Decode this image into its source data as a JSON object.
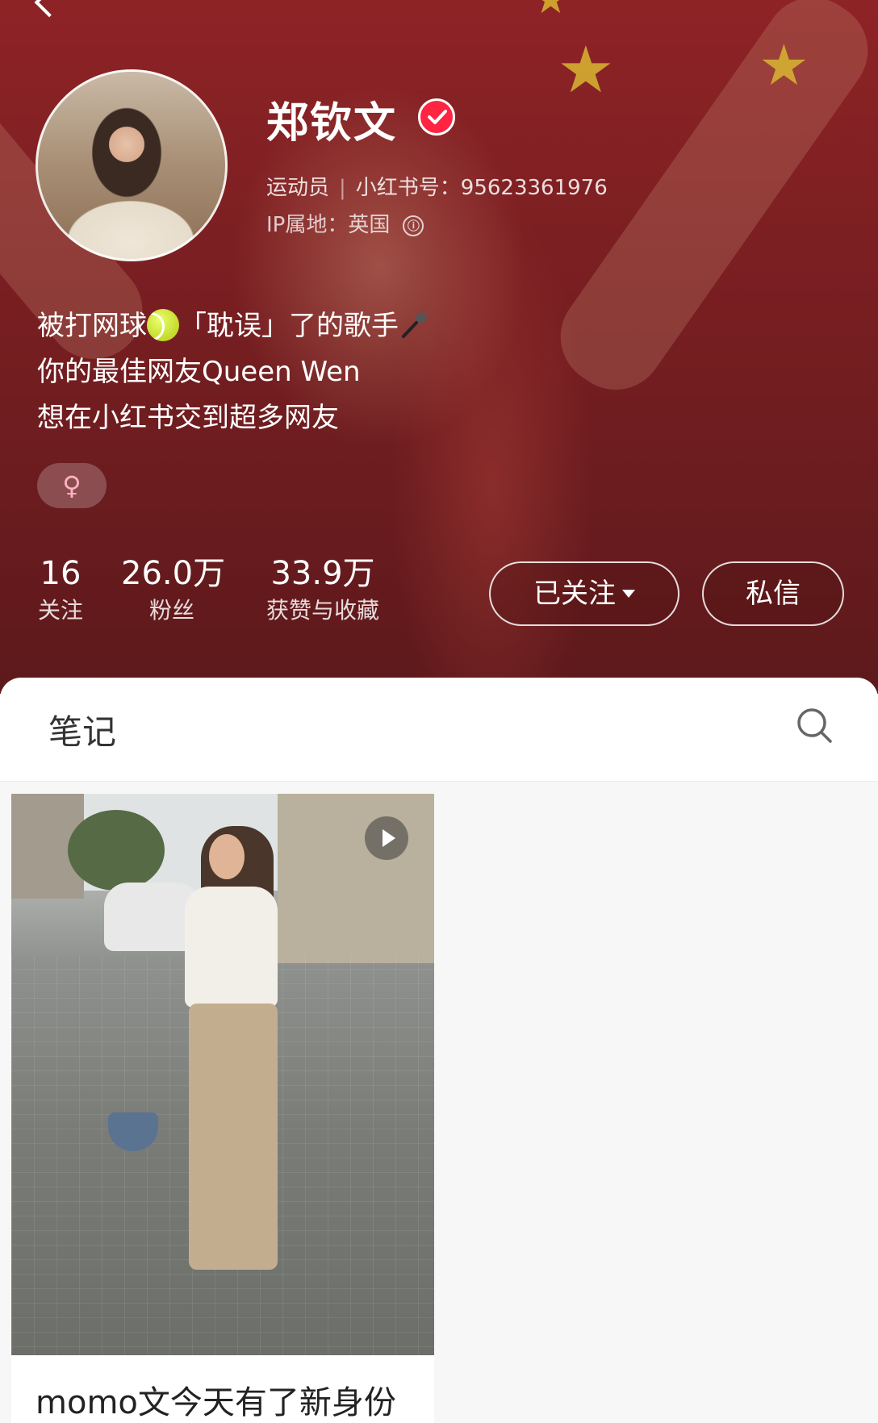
{
  "profile": {
    "name": "郑钦文",
    "role": "运动员",
    "id_label": "小红书号：",
    "id_value": "95623361976",
    "ip_label": "IP属地：",
    "ip_value": "英国",
    "info_icon": "ⓘ",
    "bio": {
      "line1_a": "被打网球",
      "line1_b": "「耽误」了的歌手",
      "line2": "你的最佳网友Queen Wen",
      "line3": "想在小红书交到超多网友"
    },
    "gender_symbol": "♀"
  },
  "stats": [
    {
      "value": "16",
      "label": "关注"
    },
    {
      "value": "26.0万",
      "label": "粉丝"
    },
    {
      "value": "33.9万",
      "label": "获赞与收藏"
    }
  ],
  "actions": {
    "follow_label": "已关注",
    "message_label": "私信"
  },
  "notes_tab": {
    "label": "笔记"
  },
  "notes": [
    {
      "title": "momo文今天有了新身份",
      "type": "video"
    }
  ],
  "colors": {
    "header_bg": "#7c1f22",
    "verified_badge": "#ff2442",
    "gender_tag_text": "#ffb3c1"
  }
}
